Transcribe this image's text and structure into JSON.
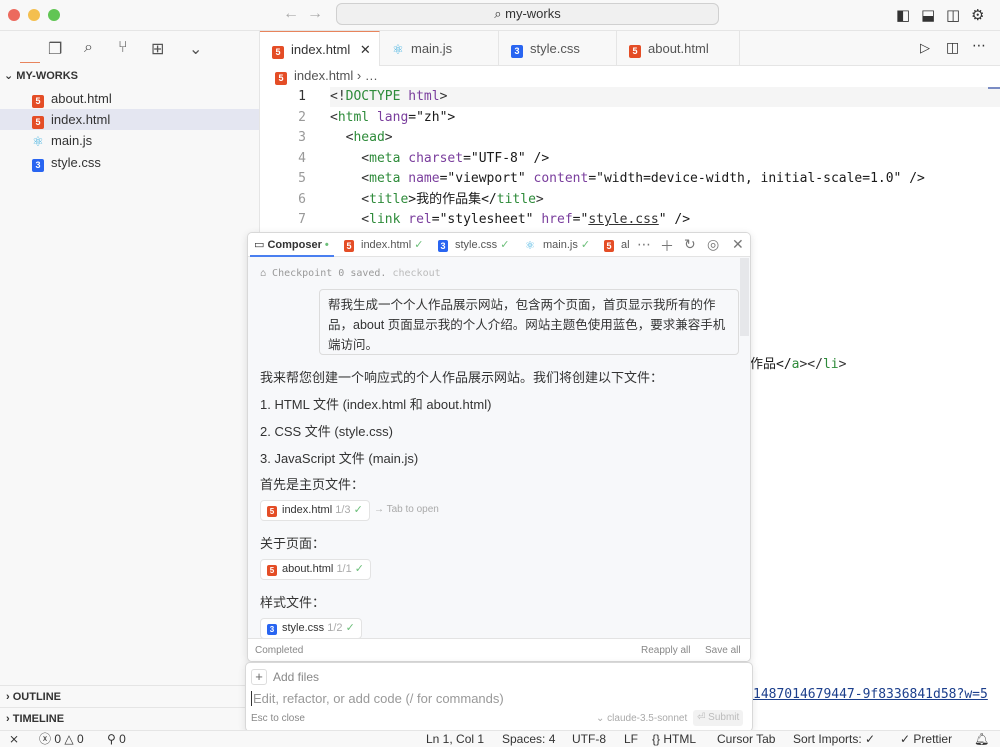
{
  "window": {
    "title": "my-works"
  },
  "activity": {
    "icons": [
      "files-icon",
      "search-icon",
      "source-control-icon",
      "extensions-icon",
      "chevron-down-icon"
    ]
  },
  "explorer": {
    "folder": "MY-WORKS",
    "files": [
      {
        "name": "about.html",
        "type": "html"
      },
      {
        "name": "index.html",
        "type": "html",
        "selected": true
      },
      {
        "name": "main.js",
        "type": "js"
      },
      {
        "name": "style.css",
        "type": "css"
      }
    ],
    "outline": "OUTLINE",
    "timeline": "TIMELINE"
  },
  "tabs": [
    {
      "label": "index.html",
      "type": "html",
      "active": true
    },
    {
      "label": "main.js",
      "type": "js"
    },
    {
      "label": "style.css",
      "type": "css"
    },
    {
      "label": "about.html",
      "type": "html"
    }
  ],
  "breadcrumb": {
    "file": "index.html",
    "rest": "…"
  },
  "code": {
    "lines": [
      {
        "n": "1",
        "tokens": [
          [
            "<!",
            "p"
          ],
          [
            "DOCTYPE",
            "t"
          ],
          [
            " ",
            "p"
          ],
          [
            "html",
            "a"
          ],
          [
            ">",
            "p"
          ]
        ]
      },
      {
        "n": "2",
        "tokens": [
          [
            "<",
            "p"
          ],
          [
            "html",
            "t"
          ],
          [
            " ",
            "p"
          ],
          [
            "lang",
            "a"
          ],
          [
            "=\"zh\">",
            "s"
          ]
        ]
      },
      {
        "n": "3",
        "tokens": [
          [
            "  <",
            "p"
          ],
          [
            "head",
            "t"
          ],
          [
            ">",
            "p"
          ]
        ]
      },
      {
        "n": "4",
        "tokens": [
          [
            "    <",
            "p"
          ],
          [
            "meta",
            "t"
          ],
          [
            " ",
            "p"
          ],
          [
            "charset",
            "a"
          ],
          [
            "=\"UTF-8\" />",
            "s"
          ]
        ]
      },
      {
        "n": "5",
        "tokens": [
          [
            "    <",
            "p"
          ],
          [
            "meta",
            "t"
          ],
          [
            " ",
            "p"
          ],
          [
            "name",
            "a"
          ],
          [
            "=\"viewport\" ",
            "s"
          ],
          [
            "content",
            "a"
          ],
          [
            "=\"width=device-width, initial-scale=1.0\" />",
            "s"
          ]
        ]
      },
      {
        "n": "6",
        "tokens": [
          [
            "    <",
            "p"
          ],
          [
            "title",
            "t"
          ],
          [
            ">我的作品集</",
            "s"
          ],
          [
            "title",
            "t"
          ],
          [
            ">",
            "p"
          ]
        ]
      },
      {
        "n": "7",
        "tokens": [
          [
            "    <",
            "p"
          ],
          [
            "link",
            "t"
          ],
          [
            " ",
            "p"
          ],
          [
            "rel",
            "a"
          ],
          [
            "=\"stylesheet\" ",
            "s"
          ],
          [
            "href",
            "a"
          ],
          [
            "=\"",
            "s"
          ],
          [
            "style.css",
            "u"
          ],
          [
            "\" />",
            "s"
          ]
        ]
      }
    ],
    "partial_line_1": [
      [
        "作品</",
        "s"
      ],
      [
        "a",
        "t"
      ],
      [
        "></",
        "p"
      ],
      [
        "li",
        "t"
      ],
      [
        ">",
        "p"
      ]
    ],
    "partial_line_2": "1487014679447-9f8336841d58?w=5"
  },
  "composer": {
    "tabs": [
      {
        "label": "Composer",
        "type": "composer"
      },
      {
        "label": "index.html",
        "type": "html"
      },
      {
        "label": "style.css",
        "type": "css"
      },
      {
        "label": "main.js",
        "type": "js"
      },
      {
        "label": "al",
        "type": "html"
      }
    ],
    "checkpoint": "Checkpoint 0 saved.",
    "checkout": "checkout",
    "user_message": "帮我生成一个个人作品展示网站，包含两个页面，首页显示我所有的作品，about 页面显示我的个人介绍。网站主题色使用蓝色，要求兼容手机端访问。",
    "reply": [
      "我来帮您创建一个响应式的个人作品展示网站。我们将创建以下文件：",
      "1. HTML 文件 (index.html 和 about.html)",
      "2. CSS 文件 (style.css)",
      "3. JavaScript 文件 (main.js)",
      "首先是主页文件：",
      "关于页面：",
      "样式文件："
    ],
    "chips": [
      {
        "file": "index.html",
        "type": "html",
        "progress": "1/3",
        "hint": "→ Tab to open"
      },
      {
        "file": "about.html",
        "type": "html",
        "progress": "1/1"
      },
      {
        "file": "style.css",
        "type": "css",
        "progress": "1/2"
      }
    ],
    "status": "Completed",
    "reapply": "Reapply all",
    "save": "Save all",
    "add_files": "Add files",
    "placeholder": "Edit, refactor, or add code (/ for commands)",
    "esc": "Esc to close",
    "model": "claude-3.5-sonnet",
    "submit": "Submit"
  },
  "statusbar": {
    "errors": "0",
    "warnings": "0",
    "ports": "0",
    "position": "Ln 1, Col 1",
    "spaces": "Spaces: 4",
    "encoding": "UTF-8",
    "eol": "LF",
    "language": "HTML",
    "cursor_tab": "Cursor Tab",
    "sort_imports": "Sort Imports: ✓",
    "prettier": "✓ Prettier"
  }
}
